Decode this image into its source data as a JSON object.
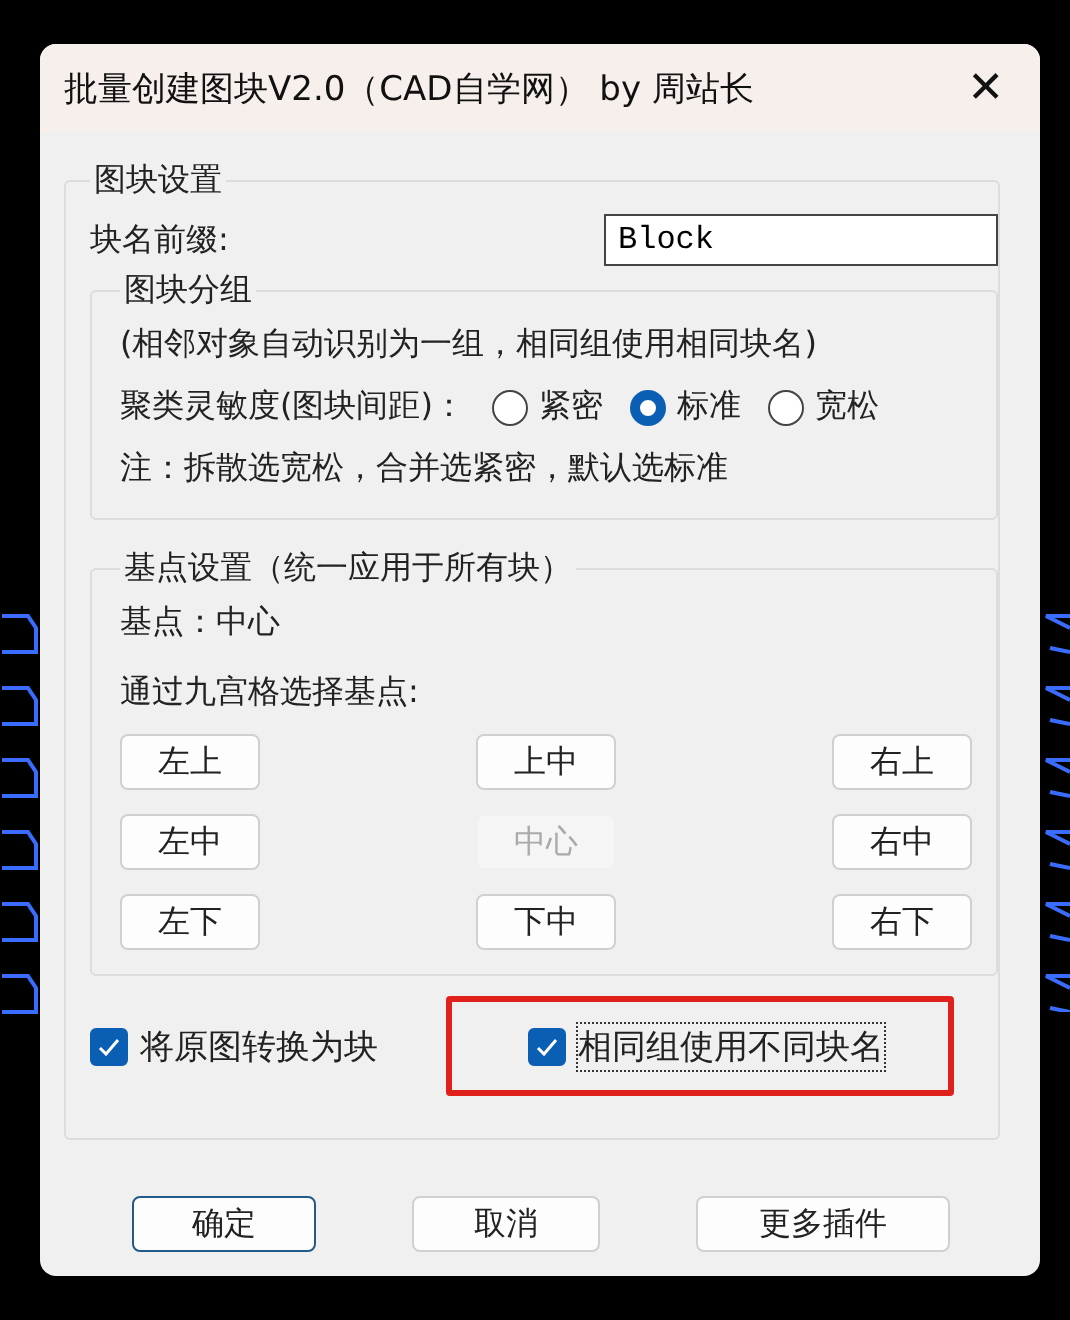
{
  "window": {
    "title": "批量创建图块V2.0（CAD自学网） by 周站长",
    "close": "✕"
  },
  "block_settings": {
    "title": "图块设置",
    "prefix_label": "块名前缀:",
    "prefix_value": "Block",
    "grouping": {
      "title": "图块分组",
      "description": "(相邻对象自动识别为一组，相同组使用相同块名)",
      "sensitivity_label": "聚类灵敏度(图块间距)：",
      "options": [
        {
          "label": "紧密",
          "selected": false
        },
        {
          "label": "标准",
          "selected": true
        },
        {
          "label": "宽松",
          "selected": false
        }
      ],
      "note": "注：拆散选宽松，合并选紧密，默认选标准"
    },
    "base_point": {
      "title": "基点设置（统一应用于所有块）",
      "current": "基点：中心",
      "grid_label": "通过九宫格选择基点:",
      "buttons": [
        {
          "label": "左上",
          "disabled": false
        },
        {
          "label": "上中",
          "disabled": false
        },
        {
          "label": "右上",
          "disabled": false
        },
        {
          "label": "左中",
          "disabled": false
        },
        {
          "label": "中心",
          "disabled": true
        },
        {
          "label": "右中",
          "disabled": false
        },
        {
          "label": "左下",
          "disabled": false
        },
        {
          "label": "下中",
          "disabled": false
        },
        {
          "label": "右下",
          "disabled": false
        }
      ]
    },
    "options": [
      {
        "label": "将原图转换为块",
        "checked": true,
        "highlighted": false
      },
      {
        "label": "相同组使用不同块名",
        "checked": true,
        "highlighted": true
      }
    ]
  },
  "buttons": [
    {
      "label": "确定",
      "default": true
    },
    {
      "label": "取消",
      "default": false
    },
    {
      "label": "更多插件",
      "default": false
    }
  ]
}
